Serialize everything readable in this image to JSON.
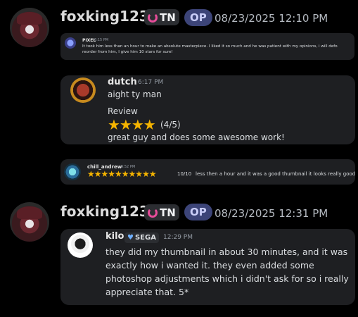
{
  "posts": [
    {
      "username": "foxking1234",
      "tag": "TN",
      "op_badge": "OP",
      "timestamp": "08/23/2025 12:10 PM",
      "reviews": [
        {
          "name": "PIXEL",
          "time": "6:15 PM",
          "text": "It took him less than an hour to make an absolute masterpiece. I liked it so much and he was patient with my opinions, i will defo reorder from him, I give him 10 stars for sure!"
        },
        {
          "name": "dutch",
          "time": "6:17 PM",
          "line1": "aight ty man",
          "line2": "Review",
          "stars": "★★★★",
          "rating": "(4/5)",
          "line3": "great guy and does some awesome work!"
        },
        {
          "name": "chill_andrew",
          "time": "9:52 PM",
          "stars": "★★★★★★★★★★",
          "rating": "10/10",
          "text": "less then a hour and it was a good thumbnail it looks really good"
        }
      ]
    },
    {
      "username": "foxking1234",
      "tag": "TN",
      "op_badge": "OP",
      "timestamp": "08/23/2025 12:31 PM",
      "reviews": [
        {
          "name": "kilo",
          "badge": "SEGA",
          "time": "12:29 PM",
          "text": "they did my thumbnail in about 30 minutes, and it was exactly how i wanted it. they even added some photoshop adjustments which i didn't ask for so i really appreciate that. 5*"
        }
      ]
    }
  ],
  "colors": {
    "background": "#000000",
    "card": "#1e1f22",
    "star": "#f5b400",
    "op_badge": "#3c4478",
    "tag_icon": "#e84d9a"
  }
}
